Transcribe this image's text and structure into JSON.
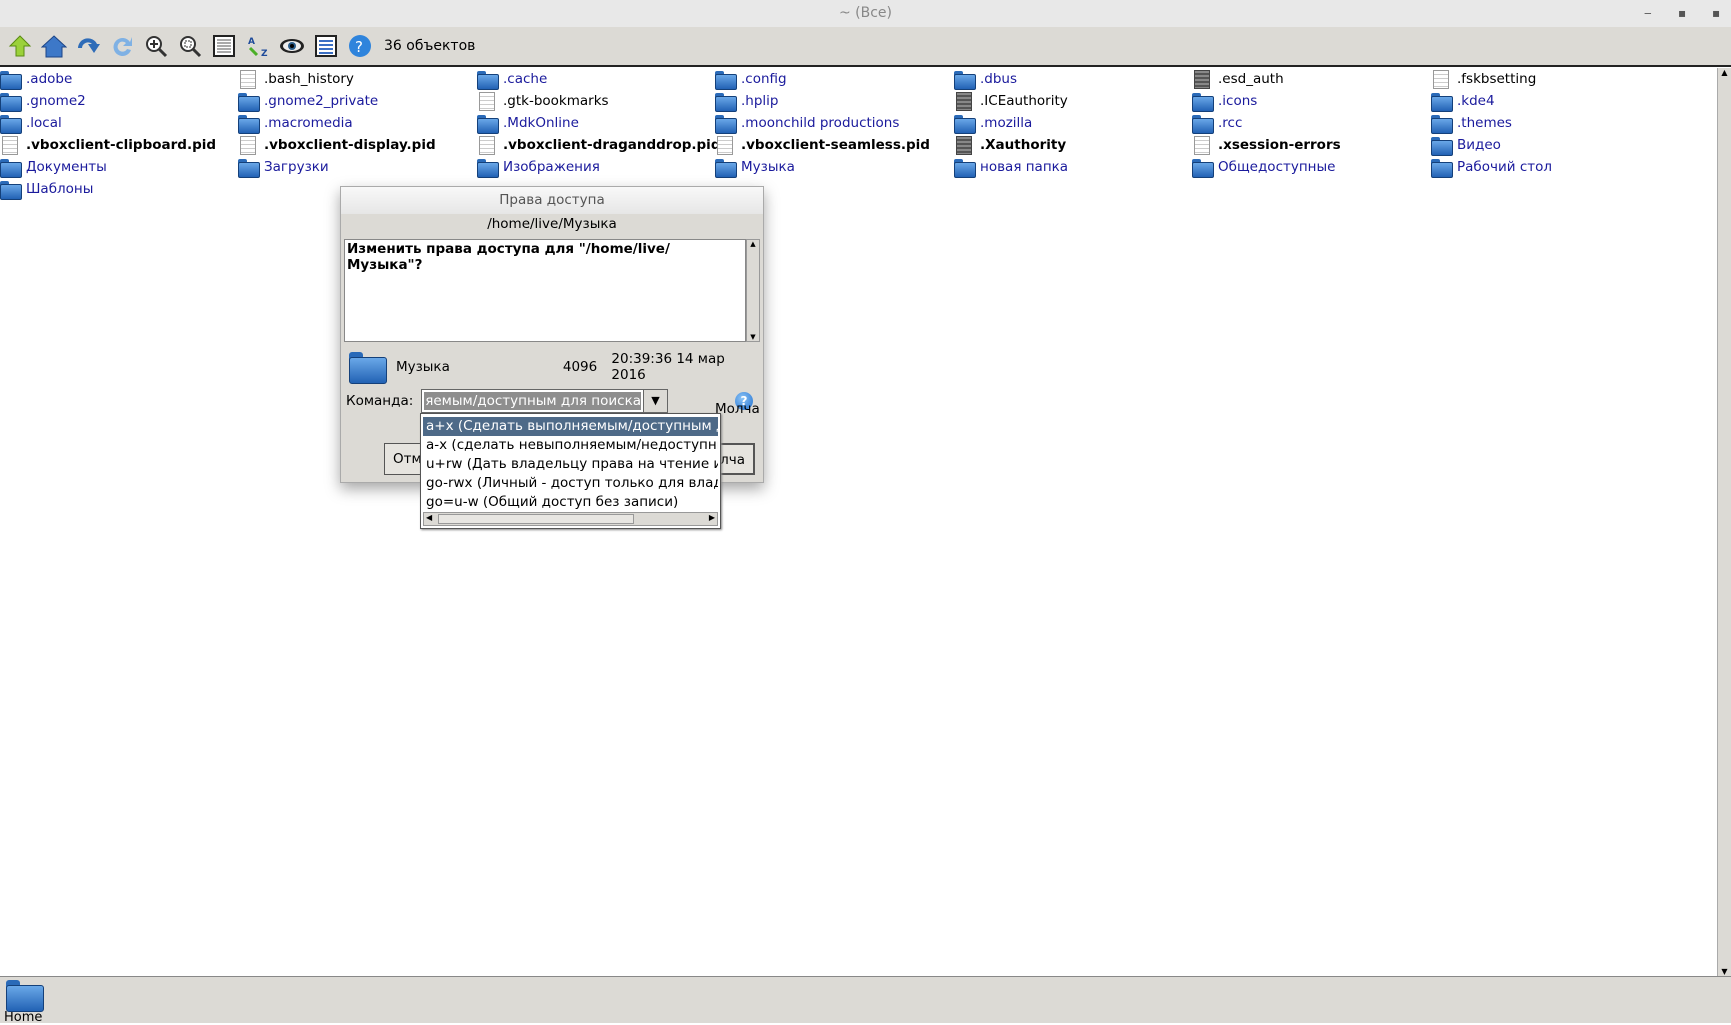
{
  "window": {
    "title": "~ (Все)"
  },
  "toolbar": {
    "buttons": [
      "up-icon",
      "home-icon",
      "back-icon",
      "refresh-icon",
      "zoom-in-icon",
      "zoom-fit-icon",
      "details-view-icon",
      "sort-az-icon",
      "show-hidden-icon",
      "list-view-icon",
      "help-icon"
    ],
    "count": "36 объектов"
  },
  "files": [
    {
      "name": ".adobe",
      "type": "folder"
    },
    {
      "name": ".bash_history",
      "type": "file"
    },
    {
      "name": ".cache",
      "type": "folder"
    },
    {
      "name": ".config",
      "type": "folder"
    },
    {
      "name": ".dbus",
      "type": "folder"
    },
    {
      "name": ".esd_auth",
      "type": "file-dark"
    },
    {
      "name": ".fskbsetting",
      "type": "file"
    },
    {
      "name": ".gnome2",
      "type": "folder"
    },
    {
      "name": ".gnome2_private",
      "type": "folder"
    },
    {
      "name": ".gtk-bookmarks",
      "type": "file"
    },
    {
      "name": ".hplip",
      "type": "folder"
    },
    {
      "name": ".ICEauthority",
      "type": "file-dark"
    },
    {
      "name": ".icons",
      "type": "folder"
    },
    {
      "name": ".kde4",
      "type": "folder"
    },
    {
      "name": ".local",
      "type": "folder"
    },
    {
      "name": ".macromedia",
      "type": "folder"
    },
    {
      "name": ".MdkOnline",
      "type": "folder"
    },
    {
      "name": ".moonchild productions",
      "type": "folder"
    },
    {
      "name": ".mozilla",
      "type": "folder"
    },
    {
      "name": ".rcc",
      "type": "folder"
    },
    {
      "name": ".themes",
      "type": "folder"
    },
    {
      "name": ".vboxclient-clipboard.pid",
      "type": "file-bold"
    },
    {
      "name": ".vboxclient-display.pid",
      "type": "file-bold"
    },
    {
      "name": ".vboxclient-draganddrop.pid",
      "type": "file-bold"
    },
    {
      "name": ".vboxclient-seamless.pid",
      "type": "file-bold"
    },
    {
      "name": ".Xauthority",
      "type": "file-dark-bold"
    },
    {
      "name": ".xsession-errors",
      "type": "file-bold"
    },
    {
      "name": "Видео",
      "type": "folder"
    },
    {
      "name": "Документы",
      "type": "folder"
    },
    {
      "name": "Загрузки",
      "type": "folder"
    },
    {
      "name": "Изображения",
      "type": "folder"
    },
    {
      "name": "Музыка",
      "type": "folder"
    },
    {
      "name": "новая папка",
      "type": "folder"
    },
    {
      "name": "Общедоступные",
      "type": "folder"
    },
    {
      "name": "Рабочий стол",
      "type": "folder"
    },
    {
      "name": "Шаблоны",
      "type": "folder"
    }
  ],
  "dialog": {
    "title": "Права доступа",
    "path": "/home/live/Музыка",
    "question": "Изменить права доступа для \"/home/live/Музыка\"?",
    "item_name": "Музыка",
    "item_size": "4096",
    "item_date": "20:39:36 14 мар 2016",
    "command_label": "Команда:",
    "command_value": "выполняемым/доступным для поиска)",
    "help": "?",
    "cancel_label": "Отм",
    "default_label": "Молча",
    "ok_label": "лча",
    "options": [
      "a+x (Сделать выполняемым/доступным для поиска)",
      "a-x (сделать невыполняемым/недоступным для поиска)",
      "u+rw (Дать владельцу права на чтение и запись)",
      "go-rwx (Личный - доступ только для владельца)",
      "go=u-w (Общий доступ без записи)"
    ]
  },
  "bottom": {
    "home_label": "Home"
  }
}
